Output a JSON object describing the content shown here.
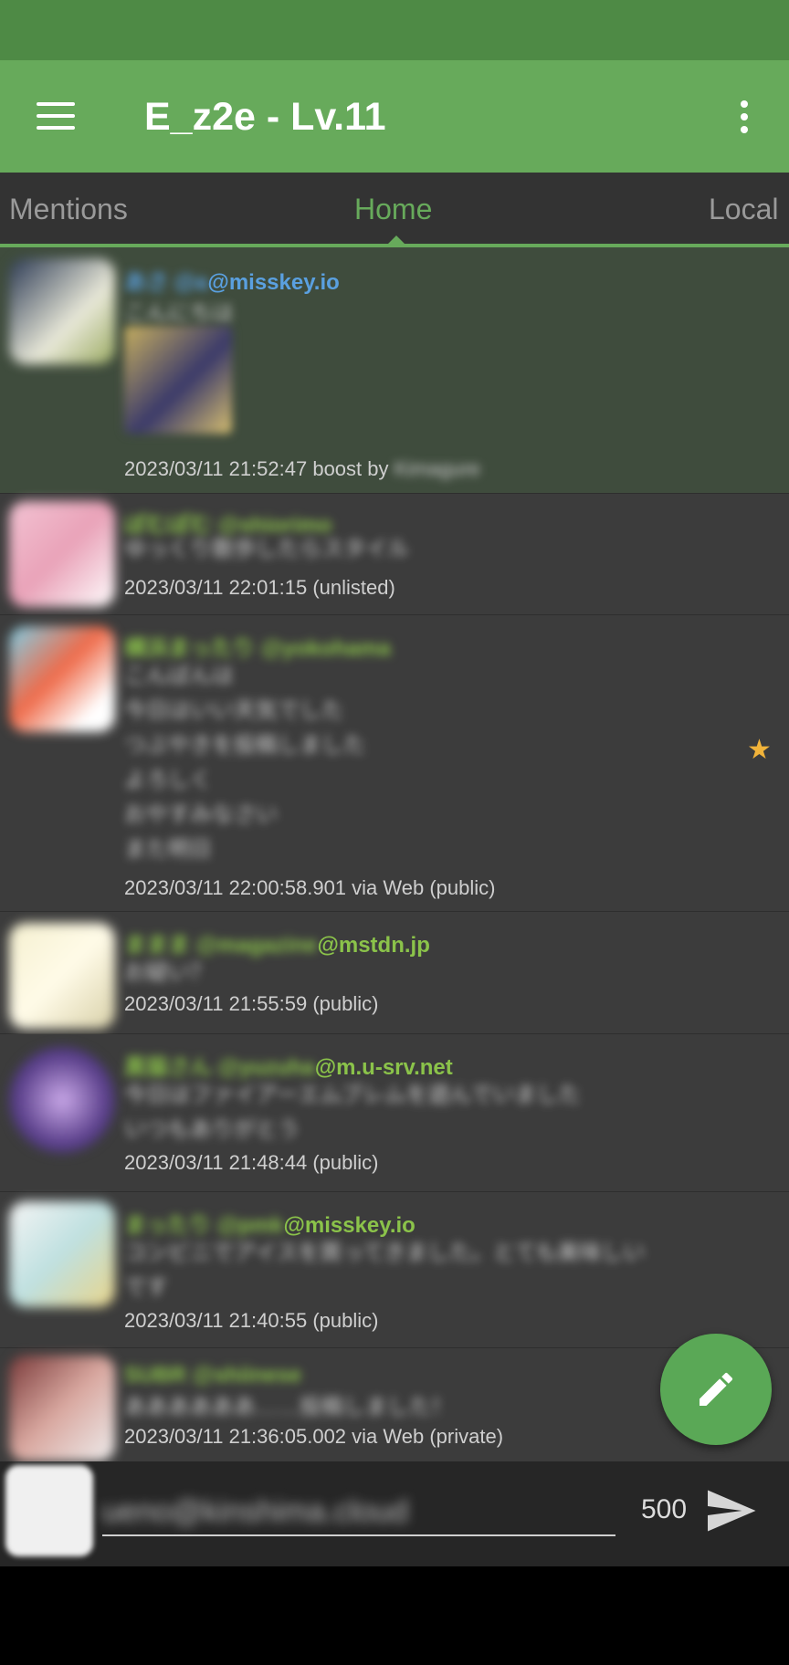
{
  "app": {
    "title": "E_z2e - Lv.11"
  },
  "tabs": [
    {
      "label": "Mentions",
      "active": false
    },
    {
      "label": "Home",
      "active": true
    },
    {
      "label": "Local",
      "active": false
    }
  ],
  "posts": [
    {
      "name_blurred": "あさ @a",
      "handle": "@misskey.io",
      "name_color": "#5aa0e0",
      "text_blurred": "こんにちは",
      "has_image": true,
      "timestamp": "2023/03/11 21:52:47 boost by",
      "boost_by_blurred": "Kimagure",
      "boosted": true
    },
    {
      "name_blurred": "ぽむぽむ @shiorimo",
      "handle": "",
      "name_color": "#8bc34a",
      "text_blurred": "ゆっくり散歩したらスタイル",
      "timestamp": "2023/03/11 22:01:15 (unlisted)"
    },
    {
      "name_blurred": "横浜まったり @yokohama",
      "handle": "",
      "name_color": "#8bc34a",
      "text_blurred_lines": [
        "こんばんは",
        "今日はいい天気でした",
        "つぶやきを投稿しました",
        "よろしく",
        "おやすみなさい",
        "また明日"
      ],
      "timestamp": "2023/03/11 22:00:58.901 via Web (public)",
      "favorited": true
    },
    {
      "name_blurred": "ままま @magazine",
      "handle": "@mstdn.jp",
      "name_color": "#8bc34a",
      "text_blurred": "お疑い？",
      "timestamp": "2023/03/11 21:55:59 (public)"
    },
    {
      "name_blurred": "黒猫さん @yuzuha",
      "handle": "@m.u-srv.net",
      "name_color": "#8bc34a",
      "text_blurred_lines": [
        "今日はファイアーエムブレムを遊んでいました",
        "いつもありがとう"
      ],
      "timestamp": "2023/03/11 21:48:44 (public)"
    },
    {
      "name_blurred": "まったり @pmk",
      "handle": "@misskey.io",
      "name_color": "#8bc34a",
      "text_blurred_lines": [
        "コンビニでアイスを買ってきました。とても美味しい",
        "です"
      ],
      "timestamp": "2023/03/11 21:40:55 (public)"
    },
    {
      "name_blurred": "SUBR @shiinese",
      "handle": "",
      "name_color": "#8bc34a",
      "text_blurred": "ああああああ……投稿しました！",
      "timestamp": "2023/03/11 21:36:05.002 via Web (private)"
    }
  ],
  "composer": {
    "placeholder_blurred": "ueno@kinshima.cloud",
    "char_count": "500"
  },
  "colors": {
    "primary": "#67aa5b",
    "status_bar": "#4e8a45",
    "fab": "#5aa856",
    "timeline_bg": "#3c3c3c"
  },
  "icons": {
    "menu": "hamburger-menu-icon",
    "more": "more-vert-icon",
    "fab": "pencil-icon",
    "send": "send-icon",
    "favorite": "star-icon"
  }
}
